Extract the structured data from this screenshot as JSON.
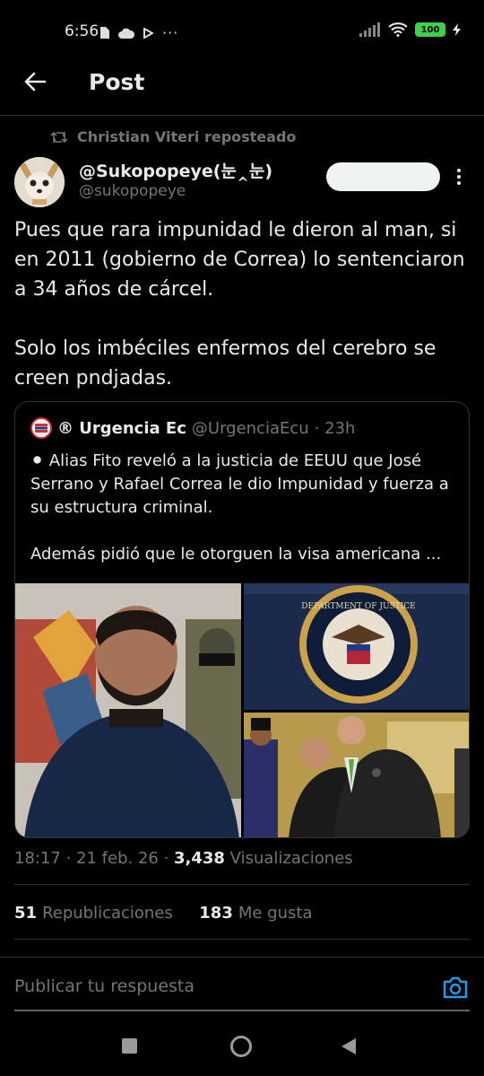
{
  "status_bar": {
    "time": "6:56",
    "battery": "100"
  },
  "header": {
    "title": "Post"
  },
  "repost": {
    "text": "Christian Viteri reposteado"
  },
  "author": {
    "display_name": "@Sukopopeye(눈‸눈)",
    "handle": "@sukopopeye"
  },
  "post": {
    "text": "Pues que rara impunidad le dieron al man, si en 2011 (gobierno de Correa) lo sentenciaron a 34 años de cárcel.\n\nSolo los imbéciles enfermos del cerebro se creen pndjadas."
  },
  "quote": {
    "name": "® Urgencia Ec",
    "handle": "@UrgenciaEcu",
    "time": "· 23h",
    "text": "⚫ Alias Fito reveló a la justicia de EEUU que José Serrano y Rafael Correa le dio Impunidad y fuerza a su estructura criminal.\n\nAdemás pidió que le otorguen la visa americana ...",
    "seal_text": "DEPARTMENT OF JUSTICE"
  },
  "meta": {
    "time_date": "18:17 · 21 feb. 26 · ",
    "views_count": "3,438",
    "views_label": " Visualizaciones"
  },
  "stats": {
    "reposts_count": "51",
    "reposts_label": "Republicaciones",
    "likes_count": "183",
    "likes_label": "Me gusta"
  },
  "reply": {
    "placeholder": "Publicar tu respuesta"
  },
  "icons": [
    "back-arrow-icon",
    "repost-icon",
    "more-icon",
    "camera-icon",
    "wifi-icon",
    "signal-icon"
  ],
  "colors": {
    "background": "#000000",
    "text": "#e7e9ea",
    "muted": "#71767b",
    "accent": "#1d9bf0",
    "battery": "#3fd04a"
  }
}
